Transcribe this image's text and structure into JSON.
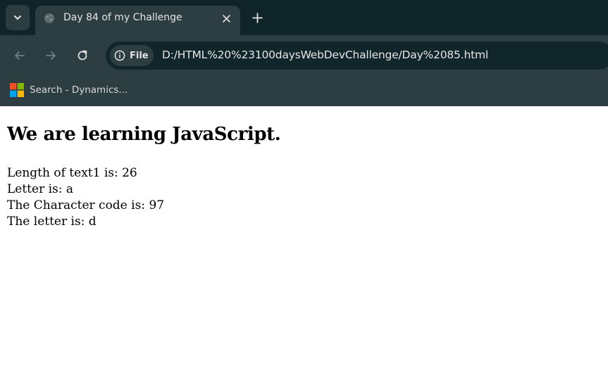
{
  "browser": {
    "tab": {
      "title": "Day 84 of my Challenge",
      "favicon": "globe-icon"
    },
    "toolbar": {
      "site_chip_label": "File",
      "url": "D:/HTML%20%23100daysWebDevChallenge/Day%2085.html"
    },
    "bookmarks": [
      {
        "label": "Search - Dynamics...",
        "icon": "windows-logo-icon"
      }
    ],
    "colors": {
      "tabstrip": "#0f2428",
      "toolbar": "#2c3e42",
      "omnibox": "#10262a"
    }
  },
  "page": {
    "heading": "We are learning JavaScript.",
    "lines": [
      "Length of text1 is: 26",
      "Letter is: a",
      "The Character code is: 97",
      "The letter is: d"
    ]
  }
}
